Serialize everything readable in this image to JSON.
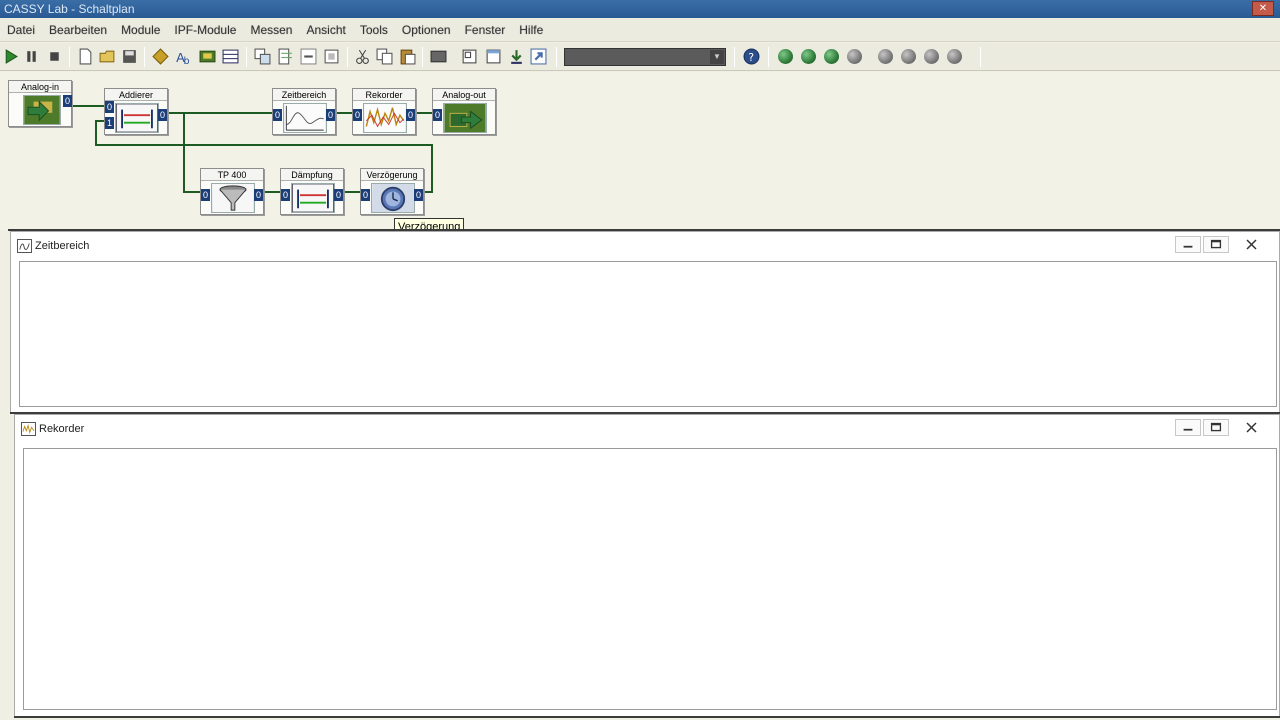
{
  "app": {
    "title": "CASSY Lab - Schaltplan",
    "close_label": "✕"
  },
  "menu": [
    "Datei",
    "Bearbeiten",
    "Module",
    "IPF-Module",
    "Messen",
    "Ansicht",
    "Tools",
    "Optionen",
    "Fenster",
    "Hilfe"
  ],
  "toolbar": {
    "combo_value": "",
    "buttons": [
      "play-icon",
      "pause-icon",
      "stop-icon",
      "new-icon",
      "open-icon",
      "save-icon",
      "module-icon",
      "text-icon",
      "image-icon",
      "table-icon",
      "tile-icon",
      "cascade-icon",
      "arrange-icon",
      "fit-icon",
      "cut-icon",
      "copy-icon",
      "paste-icon",
      "screen-icon",
      "frame-icon",
      "window-icon",
      "export-icon",
      "import-icon",
      "help-icon"
    ],
    "led_colors": [
      "#2f7d3a",
      "#2f7d3a",
      "#2f7d3a",
      "#7a7a7a",
      "#7a7a7a",
      "#7a7a7a",
      "#7a7a7a",
      "#7a7a7a"
    ]
  },
  "schematic": {
    "modules": [
      {
        "id": "analog-in",
        "title": "Analog-in",
        "in": [],
        "out": [
          "0"
        ]
      },
      {
        "id": "addierer",
        "title": "Addierer",
        "in": [
          "0",
          "1"
        ],
        "out": [
          "0"
        ]
      },
      {
        "id": "zeitbereich",
        "title": "Zeitbereich",
        "in": [
          "0"
        ],
        "out": [
          "0"
        ]
      },
      {
        "id": "rekorder",
        "title": "Rekorder",
        "in": [
          "0"
        ],
        "out": [
          "0"
        ]
      },
      {
        "id": "analog-out",
        "title": "Analog-out",
        "in": [
          "0"
        ],
        "out": []
      },
      {
        "id": "tp400",
        "title": "TP 400",
        "in": [
          "0"
        ],
        "out": [
          "0"
        ]
      },
      {
        "id": "daempfung",
        "title": "Dämpfung",
        "in": [
          "0"
        ],
        "out": [
          "0"
        ]
      },
      {
        "id": "verzoegerung",
        "title": "Verzögerung",
        "in": [
          "0"
        ],
        "out": [
          "0"
        ]
      }
    ],
    "tooltip": "Verzögerung",
    "wire_color": "#1d5a24"
  },
  "windows": [
    {
      "id": "zeitbereich",
      "title": "Zeitbereich"
    },
    {
      "id": "rekorder",
      "title": "Rekorder"
    }
  ]
}
